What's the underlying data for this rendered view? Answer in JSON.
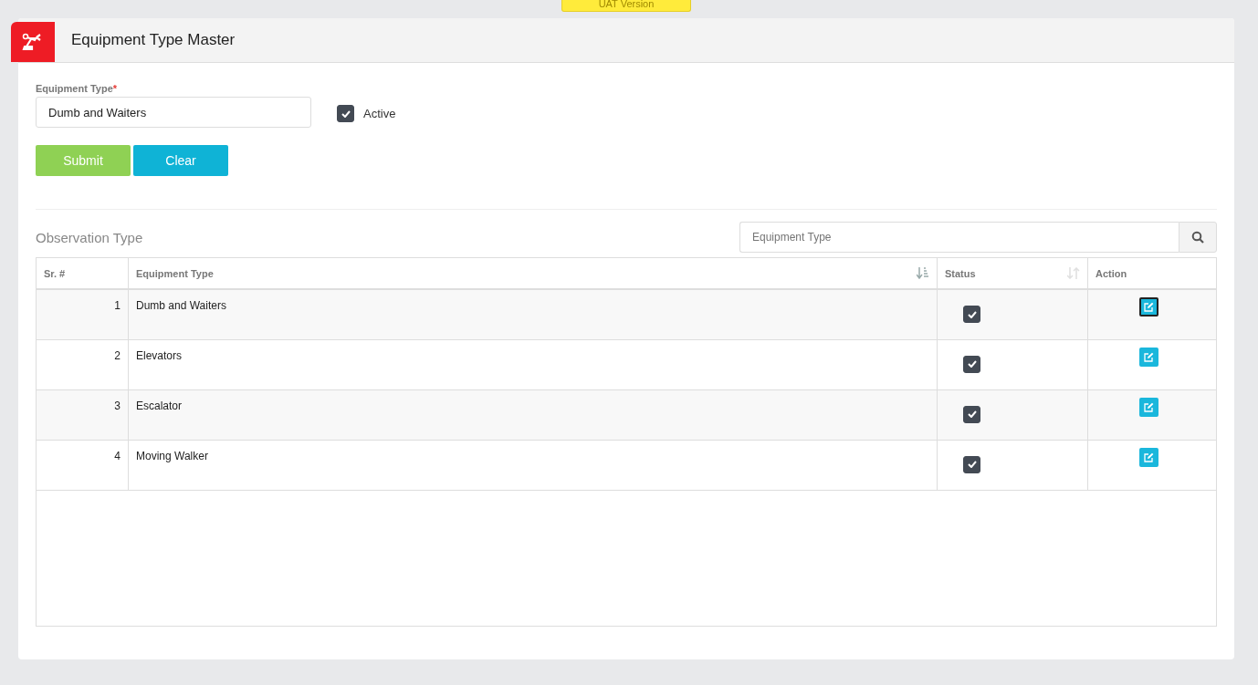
{
  "banner": "UAT Version",
  "page": {
    "title": "Equipment Type Master"
  },
  "form": {
    "field_label": "Equipment Type",
    "required_mark": "*",
    "value": "Dumb and Waiters",
    "active": {
      "label": "Active",
      "checked": true
    },
    "buttons": [
      {
        "label": "Submit",
        "kind": "submit"
      },
      {
        "label": "Clear",
        "kind": "clear"
      }
    ]
  },
  "list": {
    "title": "Observation Type",
    "search": {
      "placeholder": "Equipment Type"
    },
    "columns": [
      {
        "label": "Sr. #",
        "kind": "plain"
      },
      {
        "label": "Equipment Type",
        "kind": "sorted"
      },
      {
        "label": "Status",
        "kind": "sortable"
      },
      {
        "label": "Action",
        "kind": "plain"
      }
    ],
    "rows": [
      {
        "no": "1",
        "name": "Dumb and Waiters",
        "checked": true,
        "focused": true
      },
      {
        "no": "2",
        "name": "Elevators",
        "checked": true,
        "focused": false
      },
      {
        "no": "3",
        "name": "Escalator",
        "checked": true,
        "focused": false
      },
      {
        "no": "4",
        "name": "Moving Walker",
        "checked": true,
        "focused": false
      }
    ]
  }
}
